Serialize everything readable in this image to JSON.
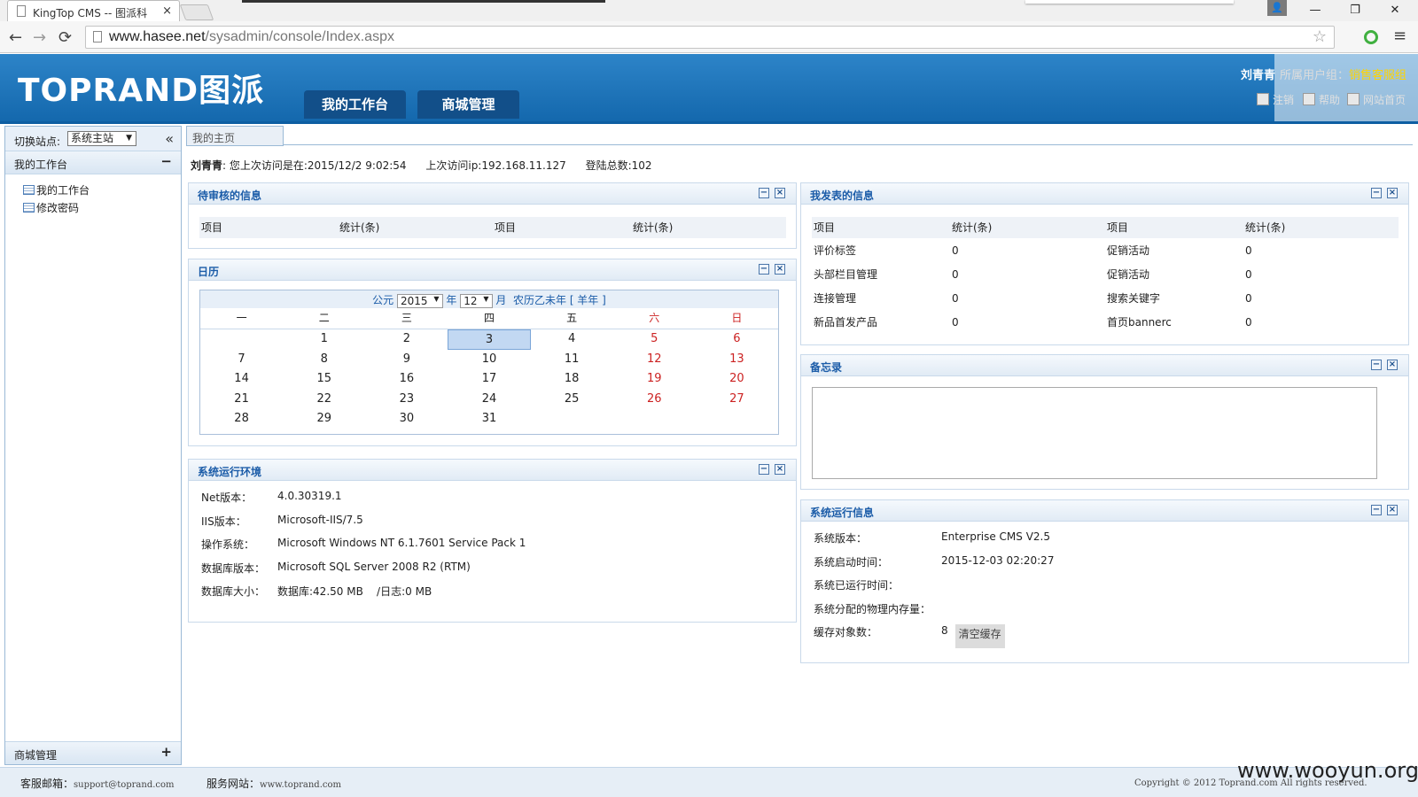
{
  "browser": {
    "tab_title": "KingTop CMS -- 图派科",
    "tab_close": "×",
    "profile_icon": "👤",
    "window_controls": {
      "minimize": "—",
      "maximize": "❐",
      "close": "✕"
    },
    "nav": {
      "back": "←",
      "forward": "→",
      "reload": "⟳"
    },
    "url_host": "www.hasee.net",
    "url_path": "/sysadmin/console/Index.aspx",
    "star": "☆",
    "menu": "≡"
  },
  "header": {
    "logo": "TOPRAND图派",
    "tabs": [
      "我的工作台",
      "商城管理"
    ],
    "user": "刘青青",
    "group": "所属用户组：",
    "role": "销售客服组",
    "links": [
      "注销",
      "帮助",
      "网站首页"
    ]
  },
  "sidebar": {
    "site_label": "切换站点:",
    "site_value": "系统主站",
    "collapse": "«",
    "section_title": "我的工作台",
    "section_toggle": "−",
    "items": [
      "我的工作台",
      "修改密码"
    ],
    "bottom_title": "商城管理",
    "bottom_toggle": "+"
  },
  "breadcrumb": "我的主页",
  "welcome": {
    "user": "刘青青",
    "last_visit": ": 您上次访问是在:2015/12/2 9:02:54",
    "last_ip": "上次访问ip:192.168.11.127",
    "login_count": "登陆总数:102"
  },
  "pending": {
    "title": "待审核的信息",
    "headers": [
      "项目",
      "统计(条)",
      "项目",
      "统计(条)"
    ]
  },
  "calendar": {
    "title": "日历",
    "era": "公元",
    "year": "2015",
    "year_suffix": "年",
    "month": "12",
    "month_suffix": "月",
    "lunar": "农历乙未年 [ 羊年 ]",
    "weekdays": [
      "一",
      "二",
      "三",
      "四",
      "五",
      "六",
      "日"
    ],
    "days": [
      "",
      "1",
      "2",
      "3",
      "4",
      "5",
      "6",
      "7",
      "8",
      "9",
      "10",
      "11",
      "12",
      "13",
      "14",
      "15",
      "16",
      "17",
      "18",
      "19",
      "20",
      "21",
      "22",
      "23",
      "24",
      "25",
      "26",
      "27",
      "28",
      "29",
      "30",
      "31",
      "",
      "",
      ""
    ],
    "today": "3",
    "weekend_color": "#cc2222"
  },
  "sysenv": {
    "title": "系统运行环境",
    "rows": [
      {
        "k": "Net版本：",
        "v": "4.0.30319.1"
      },
      {
        "k": "IIS版本：",
        "v": "Microsoft-IIS/7.5"
      },
      {
        "k": "操作系统：",
        "v": "Microsoft Windows NT 6.1.7601 Service Pack 1"
      },
      {
        "k": "数据库版本：",
        "v": "Microsoft SQL Server 2008 R2 (RTM)"
      },
      {
        "k": "数据库大小：",
        "v": "数据库:42.50 MB    /日志:0 MB"
      }
    ]
  },
  "published": {
    "title": "我发表的信息",
    "headers": [
      "项目",
      "统计(条)",
      "项目",
      "统计(条)"
    ],
    "rows": [
      [
        "评价标签",
        "0",
        "促销活动",
        "0"
      ],
      [
        "头部栏目管理",
        "0",
        "促销活动",
        "0"
      ],
      [
        "连接管理",
        "0",
        "搜索关键字",
        "0"
      ],
      [
        "新品首发产品",
        "0",
        "首页bannerc",
        "0"
      ]
    ]
  },
  "memo": {
    "title": "备忘录"
  },
  "sysinfo": {
    "title": "系统运行信息",
    "rows": [
      {
        "k": "系统版本：",
        "v": "Enterprise CMS V2.5"
      },
      {
        "k": "系统启动时间：",
        "v": "2015-12-03 02:20:27"
      },
      {
        "k": "系统已运行时间：",
        "v": ""
      },
      {
        "k": "系统分配的物理内存量：",
        "v": ""
      },
      {
        "k": "缓存对象数：",
        "v": "8"
      }
    ],
    "clear_button": "清空缓存"
  },
  "box_buttons": {
    "min": "−",
    "close": "×"
  },
  "footer": {
    "email_label": "客服邮箱：",
    "email": "support@toprand.com",
    "site_label": "服务网站：",
    "site": "www.toprand.com",
    "copyright": "Copyright © 2012 Toprand.com All rights reserved."
  },
  "watermark": "www.wooyun.org"
}
